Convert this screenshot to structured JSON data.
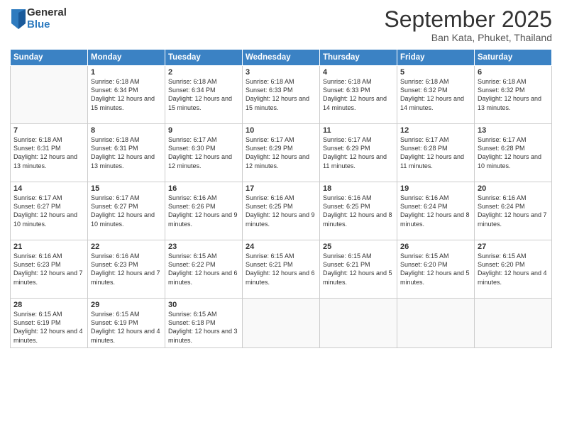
{
  "logo": {
    "general": "General",
    "blue": "Blue"
  },
  "title": "September 2025",
  "location": "Ban Kata, Phuket, Thailand",
  "days_of_week": [
    "Sunday",
    "Monday",
    "Tuesday",
    "Wednesday",
    "Thursday",
    "Friday",
    "Saturday"
  ],
  "weeks": [
    [
      {
        "day": "",
        "sunrise": "",
        "sunset": "",
        "daylight": ""
      },
      {
        "day": "1",
        "sunrise": "Sunrise: 6:18 AM",
        "sunset": "Sunset: 6:34 PM",
        "daylight": "Daylight: 12 hours and 15 minutes."
      },
      {
        "day": "2",
        "sunrise": "Sunrise: 6:18 AM",
        "sunset": "Sunset: 6:34 PM",
        "daylight": "Daylight: 12 hours and 15 minutes."
      },
      {
        "day": "3",
        "sunrise": "Sunrise: 6:18 AM",
        "sunset": "Sunset: 6:33 PM",
        "daylight": "Daylight: 12 hours and 15 minutes."
      },
      {
        "day": "4",
        "sunrise": "Sunrise: 6:18 AM",
        "sunset": "Sunset: 6:33 PM",
        "daylight": "Daylight: 12 hours and 14 minutes."
      },
      {
        "day": "5",
        "sunrise": "Sunrise: 6:18 AM",
        "sunset": "Sunset: 6:32 PM",
        "daylight": "Daylight: 12 hours and 14 minutes."
      },
      {
        "day": "6",
        "sunrise": "Sunrise: 6:18 AM",
        "sunset": "Sunset: 6:32 PM",
        "daylight": "Daylight: 12 hours and 13 minutes."
      }
    ],
    [
      {
        "day": "7",
        "sunrise": "Sunrise: 6:18 AM",
        "sunset": "Sunset: 6:31 PM",
        "daylight": "Daylight: 12 hours and 13 minutes."
      },
      {
        "day": "8",
        "sunrise": "Sunrise: 6:18 AM",
        "sunset": "Sunset: 6:31 PM",
        "daylight": "Daylight: 12 hours and 13 minutes."
      },
      {
        "day": "9",
        "sunrise": "Sunrise: 6:17 AM",
        "sunset": "Sunset: 6:30 PM",
        "daylight": "Daylight: 12 hours and 12 minutes."
      },
      {
        "day": "10",
        "sunrise": "Sunrise: 6:17 AM",
        "sunset": "Sunset: 6:29 PM",
        "daylight": "Daylight: 12 hours and 12 minutes."
      },
      {
        "day": "11",
        "sunrise": "Sunrise: 6:17 AM",
        "sunset": "Sunset: 6:29 PM",
        "daylight": "Daylight: 12 hours and 11 minutes."
      },
      {
        "day": "12",
        "sunrise": "Sunrise: 6:17 AM",
        "sunset": "Sunset: 6:28 PM",
        "daylight": "Daylight: 12 hours and 11 minutes."
      },
      {
        "day": "13",
        "sunrise": "Sunrise: 6:17 AM",
        "sunset": "Sunset: 6:28 PM",
        "daylight": "Daylight: 12 hours and 10 minutes."
      }
    ],
    [
      {
        "day": "14",
        "sunrise": "Sunrise: 6:17 AM",
        "sunset": "Sunset: 6:27 PM",
        "daylight": "Daylight: 12 hours and 10 minutes."
      },
      {
        "day": "15",
        "sunrise": "Sunrise: 6:17 AM",
        "sunset": "Sunset: 6:27 PM",
        "daylight": "Daylight: 12 hours and 10 minutes."
      },
      {
        "day": "16",
        "sunrise": "Sunrise: 6:16 AM",
        "sunset": "Sunset: 6:26 PM",
        "daylight": "Daylight: 12 hours and 9 minutes."
      },
      {
        "day": "17",
        "sunrise": "Sunrise: 6:16 AM",
        "sunset": "Sunset: 6:25 PM",
        "daylight": "Daylight: 12 hours and 9 minutes."
      },
      {
        "day": "18",
        "sunrise": "Sunrise: 6:16 AM",
        "sunset": "Sunset: 6:25 PM",
        "daylight": "Daylight: 12 hours and 8 minutes."
      },
      {
        "day": "19",
        "sunrise": "Sunrise: 6:16 AM",
        "sunset": "Sunset: 6:24 PM",
        "daylight": "Daylight: 12 hours and 8 minutes."
      },
      {
        "day": "20",
        "sunrise": "Sunrise: 6:16 AM",
        "sunset": "Sunset: 6:24 PM",
        "daylight": "Daylight: 12 hours and 7 minutes."
      }
    ],
    [
      {
        "day": "21",
        "sunrise": "Sunrise: 6:16 AM",
        "sunset": "Sunset: 6:23 PM",
        "daylight": "Daylight: 12 hours and 7 minutes."
      },
      {
        "day": "22",
        "sunrise": "Sunrise: 6:16 AM",
        "sunset": "Sunset: 6:23 PM",
        "daylight": "Daylight: 12 hours and 7 minutes."
      },
      {
        "day": "23",
        "sunrise": "Sunrise: 6:15 AM",
        "sunset": "Sunset: 6:22 PM",
        "daylight": "Daylight: 12 hours and 6 minutes."
      },
      {
        "day": "24",
        "sunrise": "Sunrise: 6:15 AM",
        "sunset": "Sunset: 6:21 PM",
        "daylight": "Daylight: 12 hours and 6 minutes."
      },
      {
        "day": "25",
        "sunrise": "Sunrise: 6:15 AM",
        "sunset": "Sunset: 6:21 PM",
        "daylight": "Daylight: 12 hours and 5 minutes."
      },
      {
        "day": "26",
        "sunrise": "Sunrise: 6:15 AM",
        "sunset": "Sunset: 6:20 PM",
        "daylight": "Daylight: 12 hours and 5 minutes."
      },
      {
        "day": "27",
        "sunrise": "Sunrise: 6:15 AM",
        "sunset": "Sunset: 6:20 PM",
        "daylight": "Daylight: 12 hours and 4 minutes."
      }
    ],
    [
      {
        "day": "28",
        "sunrise": "Sunrise: 6:15 AM",
        "sunset": "Sunset: 6:19 PM",
        "daylight": "Daylight: 12 hours and 4 minutes."
      },
      {
        "day": "29",
        "sunrise": "Sunrise: 6:15 AM",
        "sunset": "Sunset: 6:19 PM",
        "daylight": "Daylight: 12 hours and 4 minutes."
      },
      {
        "day": "30",
        "sunrise": "Sunrise: 6:15 AM",
        "sunset": "Sunset: 6:18 PM",
        "daylight": "Daylight: 12 hours and 3 minutes."
      },
      {
        "day": "",
        "sunrise": "",
        "sunset": "",
        "daylight": ""
      },
      {
        "day": "",
        "sunrise": "",
        "sunset": "",
        "daylight": ""
      },
      {
        "day": "",
        "sunrise": "",
        "sunset": "",
        "daylight": ""
      },
      {
        "day": "",
        "sunrise": "",
        "sunset": "",
        "daylight": ""
      }
    ]
  ]
}
